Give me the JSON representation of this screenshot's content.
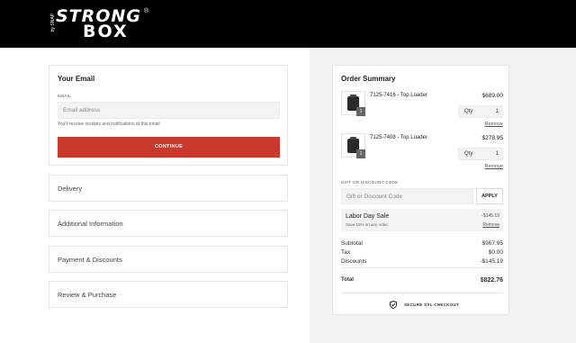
{
  "brand": {
    "logo_word_top": "STRONG",
    "logo_word_bottom": "BOX",
    "logo_registered": "®",
    "logo_side_text": "by SNAP"
  },
  "checkout": {
    "email": {
      "title": "Your Email",
      "field_label": "EMAIL",
      "placeholder": "Email address",
      "hint": "You'll receive receipts and notifications at this email",
      "continue_label": "CONTINUE"
    },
    "steps": [
      {
        "label": "Delivery"
      },
      {
        "label": "Additional Information"
      },
      {
        "label": "Payment & Discounts"
      },
      {
        "label": "Review & Purchase"
      }
    ]
  },
  "summary": {
    "title": "Order Summary",
    "items": [
      {
        "name": "7125-7416 - Top Loader",
        "price": "$689.00",
        "qty_label": "Qty",
        "qty": "1",
        "badge": "1",
        "remove": "Remove"
      },
      {
        "name": "7125-7408 - Top Loader",
        "price": "$278.95",
        "qty_label": "Qty",
        "qty": "1",
        "badge": "1",
        "remove": "Remove"
      }
    ],
    "gift": {
      "label": "GIFT OR DISCOUNT CODE",
      "placeholder": "Gift or Discount Code",
      "apply_label": "APPLY"
    },
    "promo": {
      "name": "Labor Day Sale",
      "description": "Save 15% on any order.",
      "amount": "-$145.19",
      "remove": "Remove"
    },
    "totals": {
      "subtotal_label": "Subtotal",
      "subtotal": "$967.95",
      "tax_label": "Tax",
      "tax": "$0.00",
      "discounts_label": "Discounts",
      "discounts": "-$145.19",
      "total_label": "Total",
      "total": "$822.76"
    },
    "ssl_text": "SECURE SSL CHECKOUT"
  },
  "icons": {
    "ssl": "shield-check-icon",
    "product": "storage-case-image"
  },
  "colors": {
    "header_bg": "#000000",
    "accent": "#c9392c",
    "summary_bg": "#f2f2f2"
  }
}
